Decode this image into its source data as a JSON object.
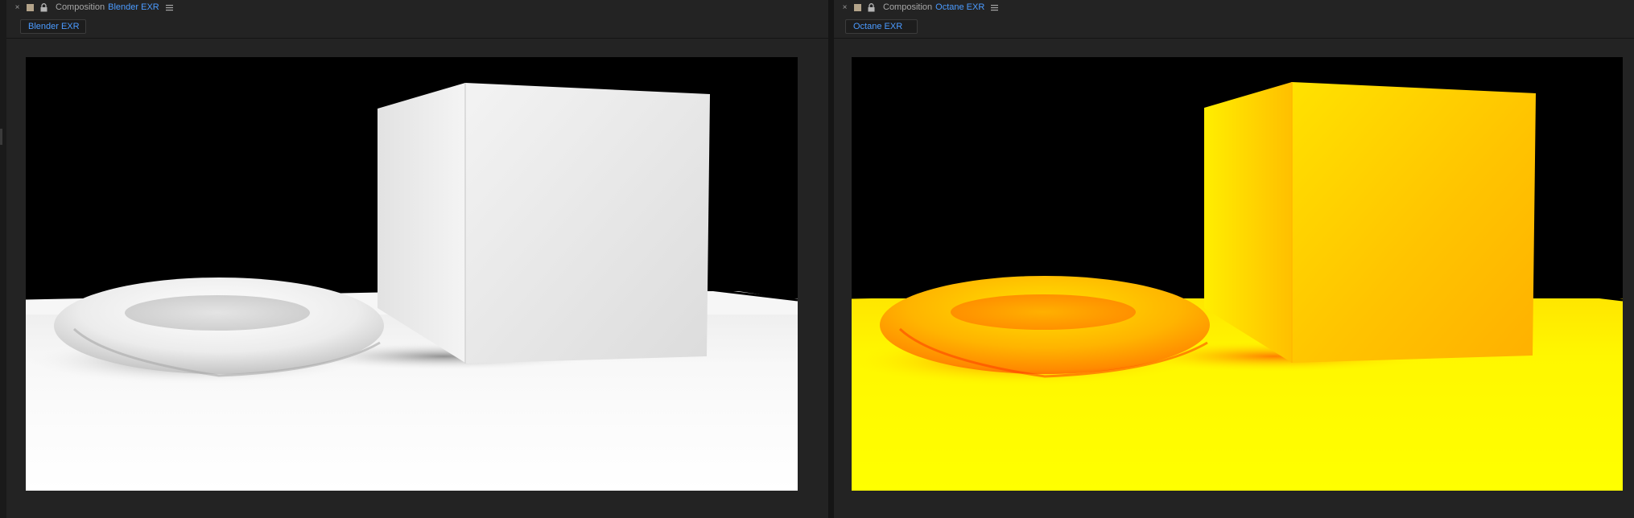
{
  "panels": [
    {
      "id": "left",
      "tab_prefix": "Composition",
      "tab_name": "Blender EXR",
      "breadcrumb": "Blender EXR",
      "render_style": "grayscale"
    },
    {
      "id": "right",
      "tab_prefix": "Composition",
      "tab_name": "Octane EXR",
      "breadcrumb": "Octane EXR",
      "render_style": "heatmap-yellow-orange"
    }
  ],
  "icons": {
    "close": "close-icon",
    "label": "label-color-swatch",
    "lock": "lock-icon",
    "menu": "panel-menu-icon"
  },
  "colors": {
    "accent": "#4b9bff",
    "panel_bg": "#232323",
    "label_swatch": "#b4a48a"
  }
}
